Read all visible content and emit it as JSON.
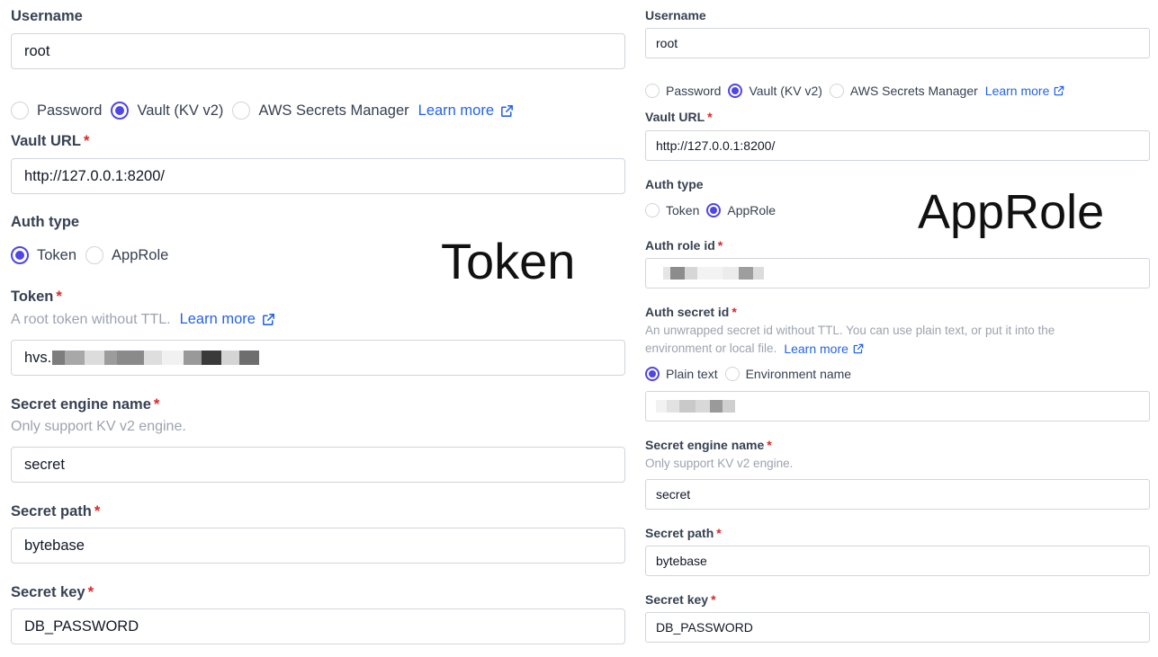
{
  "left": {
    "username": {
      "label": "Username",
      "value": "root"
    },
    "source_radios": [
      {
        "label": "Password",
        "checked": false
      },
      {
        "label": "Vault (KV v2)",
        "checked": true
      },
      {
        "label": "AWS Secrets Manager",
        "checked": false
      }
    ],
    "source_learn_more": "Learn more",
    "vault_url": {
      "label": "Vault URL",
      "value": "http://127.0.0.1:8200/"
    },
    "auth_type": {
      "label": "Auth type",
      "options": [
        {
          "label": "Token",
          "checked": true
        },
        {
          "label": "AppRole",
          "checked": false
        }
      ]
    },
    "token": {
      "label": "Token",
      "hint": "A root token without TTL.",
      "learn_more": "Learn more",
      "value_prefix": "hvs."
    },
    "secret_engine_name": {
      "label": "Secret engine name",
      "hint": "Only support KV v2 engine.",
      "value": "secret"
    },
    "secret_path": {
      "label": "Secret path",
      "value": "bytebase"
    },
    "secret_key": {
      "label": "Secret key",
      "value": "DB_PASSWORD"
    },
    "caption": "Token"
  },
  "right": {
    "username": {
      "label": "Username",
      "value": "root"
    },
    "source_radios": [
      {
        "label": "Password",
        "checked": false
      },
      {
        "label": "Vault (KV v2)",
        "checked": true
      },
      {
        "label": "AWS Secrets Manager",
        "checked": false
      }
    ],
    "source_learn_more": "Learn more",
    "vault_url": {
      "label": "Vault URL",
      "value": "http://127.0.0.1:8200/"
    },
    "auth_type": {
      "label": "Auth type",
      "options": [
        {
          "label": "Token",
          "checked": false
        },
        {
          "label": "AppRole",
          "checked": true
        }
      ]
    },
    "auth_role_id": {
      "label": "Auth role id"
    },
    "auth_secret_id": {
      "label": "Auth secret id",
      "hint_line1": "An unwrapped secret id without TTL. You can use plain text, or put it into the",
      "hint_line2": "environment or local file.",
      "learn_more": "Learn more",
      "options": [
        {
          "label": "Plain text",
          "checked": true
        },
        {
          "label": "Environment name",
          "checked": false
        }
      ]
    },
    "secret_engine_name": {
      "label": "Secret engine name",
      "hint": "Only support KV v2 engine.",
      "value": "secret"
    },
    "secret_path": {
      "label": "Secret path",
      "value": "bytebase"
    },
    "secret_key": {
      "label": "Secret key",
      "value": "DB_PASSWORD"
    },
    "caption": "AppRole"
  },
  "colors": {
    "accent": "#4f46e5",
    "link": "#2563eb",
    "required": "#dc2626"
  },
  "icons": {
    "external_link": "external-link-icon"
  }
}
